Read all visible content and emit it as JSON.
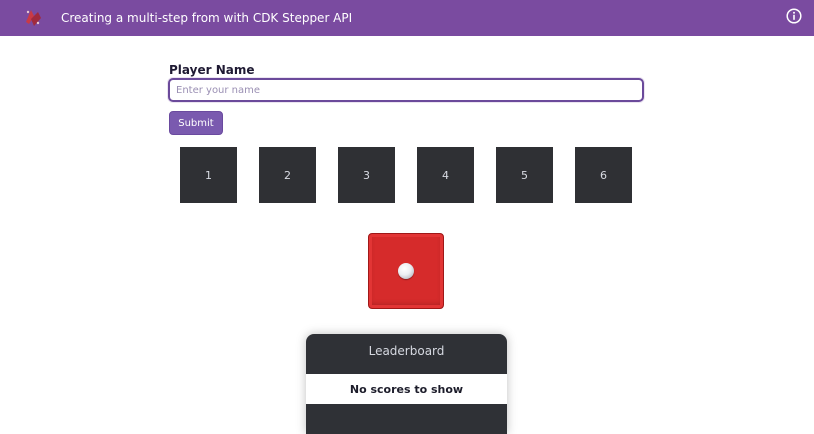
{
  "header": {
    "title": "Creating a multi-step from with CDK Stepper API",
    "logo_icon": "logo-icon",
    "info_icon": "info-icon",
    "background_color": "#7a4ba0"
  },
  "form": {
    "label": "Player Name",
    "input_placeholder": "Enter your name",
    "input_value": "",
    "submit_label": "Submit",
    "accent_color": "#7a5aaf"
  },
  "dice_faces": [
    "1",
    "2",
    "3",
    "4",
    "5",
    "6"
  ],
  "die": {
    "value": 1,
    "color": "#d62b2b"
  },
  "leaderboard": {
    "title": "Leaderboard",
    "empty_message": "No scores to show"
  }
}
